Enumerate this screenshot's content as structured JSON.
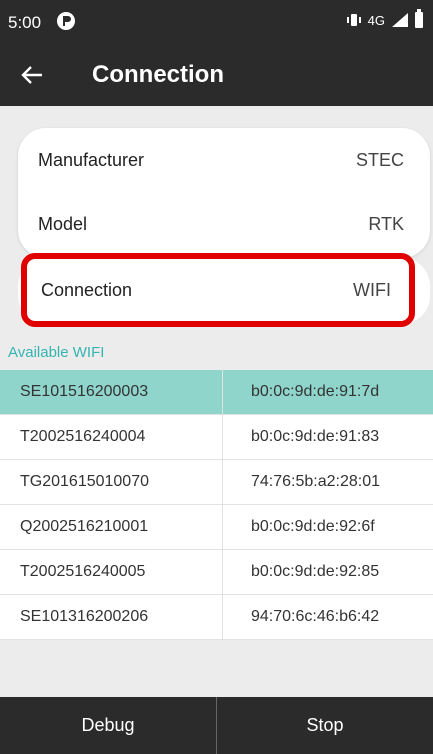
{
  "status_bar": {
    "time": "5:00",
    "network": "4G"
  },
  "app_bar": {
    "title": "Connection"
  },
  "settings": [
    {
      "label": "Manufacturer",
      "value": "STEC"
    },
    {
      "label": "Model",
      "value": "RTK"
    }
  ],
  "connection": {
    "label": "Connection",
    "value": "WIFI"
  },
  "wifi": {
    "section_label": "Available WIFI",
    "rows": [
      {
        "name": "SE101516200003",
        "mac": "b0:0c:9d:de:91:7d",
        "selected": true
      },
      {
        "name": "T2002516240004",
        "mac": "b0:0c:9d:de:91:83"
      },
      {
        "name": "TG201615010070",
        "mac": "74:76:5b:a2:28:01"
      },
      {
        "name": "Q2002516210001",
        "mac": "b0:0c:9d:de:92:6f"
      },
      {
        "name": "T2002516240005",
        "mac": "b0:0c:9d:de:92:85"
      },
      {
        "name": "SE101316200206",
        "mac": "94:70:6c:46:b6:42"
      }
    ]
  },
  "bottom_bar": {
    "debug_label": "Debug",
    "stop_label": "Stop"
  },
  "colors": {
    "bar": "#2b2b2b",
    "accent": "#35b5b0",
    "selected_row": "#8fd5cc",
    "highlight": "#e00000"
  }
}
